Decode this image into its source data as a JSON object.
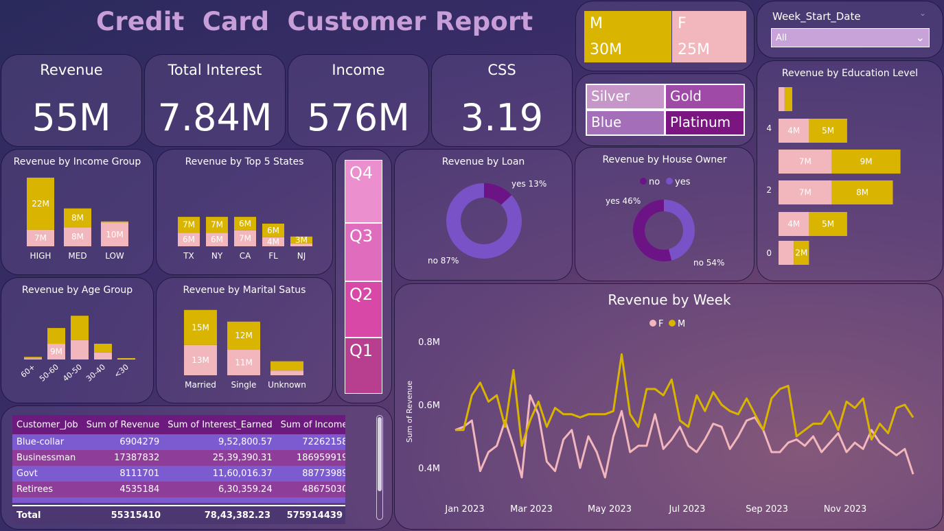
{
  "title": "Credit  Card  Customer Report",
  "kpis": [
    {
      "label": "Revenue",
      "value": "55M"
    },
    {
      "label": "Total Interest",
      "value": "7.84M"
    },
    {
      "label": "Income",
      "value": "576M"
    },
    {
      "label": "CSS",
      "value": "3.19"
    }
  ],
  "gender_tiles": [
    {
      "label": "M",
      "value": "30M",
      "color": "#d9b400"
    },
    {
      "label": "F",
      "value": "25M",
      "color": "#f2b6bd"
    }
  ],
  "card_types": [
    {
      "label": "Silver",
      "color": "#c796c8"
    },
    {
      "label": "Gold",
      "color": "#a04aa8"
    },
    {
      "label": "Blue",
      "color": "#a46eb9"
    },
    {
      "label": "Platinum",
      "color": "#7a1582"
    }
  ],
  "quarters": [
    {
      "label": "Q4",
      "color": "#ec8fcf"
    },
    {
      "label": "Q3",
      "color": "#e06cbd"
    },
    {
      "label": "Q2",
      "color": "#d849a7"
    },
    {
      "label": "Q1",
      "color": "#b83e8f"
    }
  ],
  "slicer": {
    "label": "Week_Start_Date",
    "value": "All"
  },
  "table": {
    "headers": [
      "Customer_Job",
      "Sum of Revenue",
      "Sum of Interest_Earned",
      "Sum of Income"
    ],
    "rows": [
      [
        "Blue-collar",
        "6904279",
        "9,52,800.57",
        "72262158"
      ],
      [
        "Businessman",
        "17387832",
        "25,39,390.31",
        "186959919"
      ],
      [
        "Govt",
        "8111701",
        "11,60,016.37",
        "88773989"
      ],
      [
        "Retirees",
        "4535184",
        "6,30,359.24",
        "48675030"
      ]
    ],
    "total": [
      "Total",
      "55315410",
      "78,43,382.23",
      "575914439"
    ]
  },
  "colors": {
    "gold": "#d9b400",
    "pink": "#f2b6bd",
    "purple_light": "#7a52c8",
    "purple_dark": "#6c1385"
  },
  "chart_data": [
    {
      "type": "bar",
      "stacked": true,
      "title": "Revenue by Income Group",
      "categories": [
        "HIGH",
        "MED",
        "LOW"
      ],
      "series": [
        {
          "name": "F",
          "values": [
            7,
            8,
            10
          ],
          "labels": [
            "7M",
            "8M",
            "10M"
          ]
        },
        {
          "name": "M",
          "values": [
            22,
            8,
            0.5
          ],
          "labels": [
            "22M",
            "8M",
            ""
          ]
        }
      ]
    },
    {
      "type": "bar",
      "stacked": true,
      "title": "Revenue by Top 5 States",
      "categories": [
        "TX",
        "NY",
        "CA",
        "FL",
        "NJ"
      ],
      "series": [
        {
          "name": "F",
          "values": [
            6,
            6,
            7,
            4,
            1.3
          ],
          "labels": [
            "6M",
            "6M",
            "7M",
            "4M",
            ""
          ]
        },
        {
          "name": "M",
          "values": [
            7,
            7,
            6,
            6,
            3
          ],
          "labels": [
            "7M",
            "7M",
            "6M",
            "6M",
            "3M"
          ]
        }
      ]
    },
    {
      "type": "bar",
      "stacked": true,
      "title": "Revenue by Age Group",
      "categories": [
        "60+",
        "50-60",
        "40-50",
        "30-40",
        "<30"
      ],
      "series": [
        {
          "name": "F",
          "values": [
            0.7,
            9,
            11,
            4,
            0.4
          ],
          "labels": [
            "",
            "9M",
            "",
            "",
            ""
          ]
        },
        {
          "name": "M",
          "values": [
            0.8,
            9,
            14,
            5,
            0.4
          ],
          "labels": [
            "",
            "",
            "",
            "",
            ""
          ]
        }
      ]
    },
    {
      "type": "bar",
      "stacked": true,
      "title": "Revenue by Marital Satus",
      "categories": [
        "Married",
        "Single",
        "Unknown"
      ],
      "series": [
        {
          "name": "F",
          "values": [
            13,
            11,
            2
          ],
          "labels": [
            "13M",
            "11M",
            ""
          ]
        },
        {
          "name": "M",
          "values": [
            15,
            12,
            4
          ],
          "labels": [
            "15M",
            "12M",
            ""
          ]
        }
      ]
    },
    {
      "type": "pie",
      "title": "Revenue by Loan",
      "slices": [
        {
          "label": "yes",
          "value": 13,
          "text": "yes 13%",
          "color": "#6c1385"
        },
        {
          "label": "no",
          "value": 87,
          "text": "no 87%",
          "color": "#7a52c8"
        }
      ]
    },
    {
      "type": "pie",
      "title": "Revenue by House Owner",
      "legend": [
        "no",
        "yes"
      ],
      "slices": [
        {
          "label": "yes",
          "value": 46,
          "text": "yes 46%",
          "color": "#7a52c8"
        },
        {
          "label": "no",
          "value": 54,
          "text": "no 54%",
          "color": "#6c1385"
        }
      ]
    },
    {
      "type": "bar",
      "orientation": "horizontal",
      "stacked": true,
      "title": "Revenue by Education Level",
      "y_ticks": [
        "4",
        "2",
        "0"
      ],
      "series": [
        {
          "name": "F",
          "values": [
            0.8,
            4,
            7,
            7,
            4,
            2
          ],
          "labels": [
            "",
            "4M",
            "7M",
            "7M",
            "4M",
            ""
          ]
        },
        {
          "name": "M",
          "values": [
            1,
            5,
            9,
            8,
            5,
            2
          ],
          "labels": [
            "",
            "5M",
            "9M",
            "8M",
            "5M",
            "2M"
          ]
        }
      ]
    },
    {
      "type": "line",
      "title": "Revenue by Week",
      "ylabel": "Sum of Revenue",
      "legend": [
        "F",
        "M"
      ],
      "y_ticks": [
        "0.8M",
        "0.6M",
        "0.4M"
      ],
      "ylim": [
        0.4,
        0.8
      ],
      "x_ticks": [
        "Jan 2023",
        "Mar 2023",
        "May 2023",
        "Jul 2023",
        "Sep 2023",
        "Nov 2023"
      ],
      "series": [
        {
          "name": "F",
          "color": "#f2b6bd",
          "values": [
            0.52,
            0.53,
            0.55,
            0.39,
            0.45,
            0.47,
            0.55,
            0.47,
            0.37,
            0.63,
            0.57,
            0.42,
            0.39,
            0.49,
            0.52,
            0.4,
            0.5,
            0.45,
            0.37,
            0.5,
            0.58,
            0.45,
            0.47,
            0.47,
            0.57,
            0.46,
            0.49,
            0.53,
            0.47,
            0.45,
            0.49,
            0.54,
            0.53,
            0.46,
            0.5,
            0.55,
            0.56,
            0.52,
            0.45,
            0.45,
            0.48,
            0.49,
            0.47,
            0.5,
            0.45,
            0.48,
            0.51,
            0.45,
            0.48,
            0.46,
            0.52,
            0.48,
            0.46,
            0.44,
            0.46,
            0.38
          ]
        },
        {
          "name": "M",
          "color": "#d9b400",
          "values": [
            0.52,
            0.52,
            0.63,
            0.67,
            0.61,
            0.63,
            0.53,
            0.71,
            0.47,
            0.55,
            0.61,
            0.53,
            0.59,
            0.57,
            0.57,
            0.56,
            0.57,
            0.57,
            0.57,
            0.58,
            0.76,
            0.57,
            0.53,
            0.65,
            0.65,
            0.63,
            0.68,
            0.55,
            0.53,
            0.63,
            0.58,
            0.64,
            0.6,
            0.58,
            0.57,
            0.62,
            0.57,
            0.52,
            0.62,
            0.65,
            0.66,
            0.5,
            0.52,
            0.54,
            0.54,
            0.58,
            0.52,
            0.61,
            0.59,
            0.62,
            0.49,
            0.54,
            0.51,
            0.59,
            0.6,
            0.56
          ]
        }
      ]
    }
  ]
}
